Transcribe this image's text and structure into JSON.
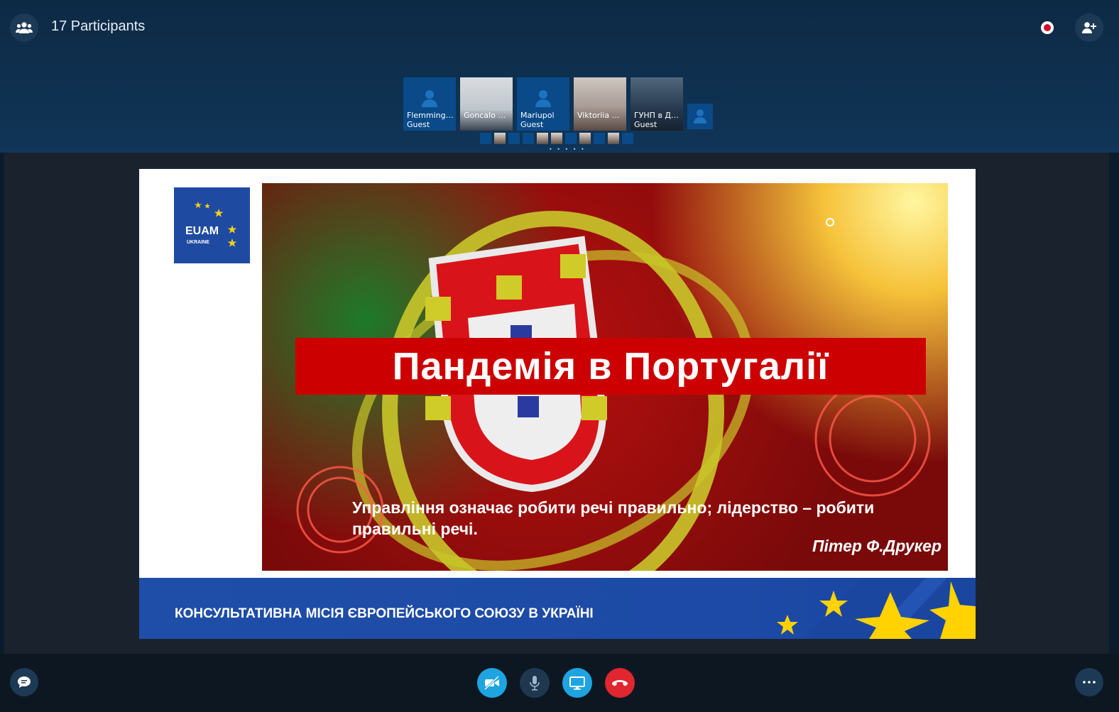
{
  "header": {
    "participants_label": "17 Participants"
  },
  "participants": [
    {
      "name": "Flemming…",
      "sub": "Guest"
    },
    {
      "name": "Goncalo C…",
      "sub": ""
    },
    {
      "name": "Mariupol",
      "sub": "Guest"
    },
    {
      "name": "Viktoriia S…",
      "sub": ""
    },
    {
      "name": "ГУНП в До…",
      "sub": "Guest"
    }
  ],
  "slide": {
    "logo_text": "EUAM",
    "logo_sub": "UKRAINE",
    "title": "Пандемія в Португалії",
    "quote": "Управління означає робити речі правильно; лідерство – робити правильні речі.",
    "author": "Пітер Ф.Друкер",
    "footer": "КОНСУЛЬТАТИВНА МІСІЯ ЄВРОПЕЙСЬКОГО СОЮЗУ В УКРАЇНІ"
  },
  "colors": {
    "accent_blue": "#1ea4e0",
    "hangup_red": "#e0262f",
    "slide_title_red": "#cc0000",
    "eu_blue": "#1e4aa2"
  }
}
